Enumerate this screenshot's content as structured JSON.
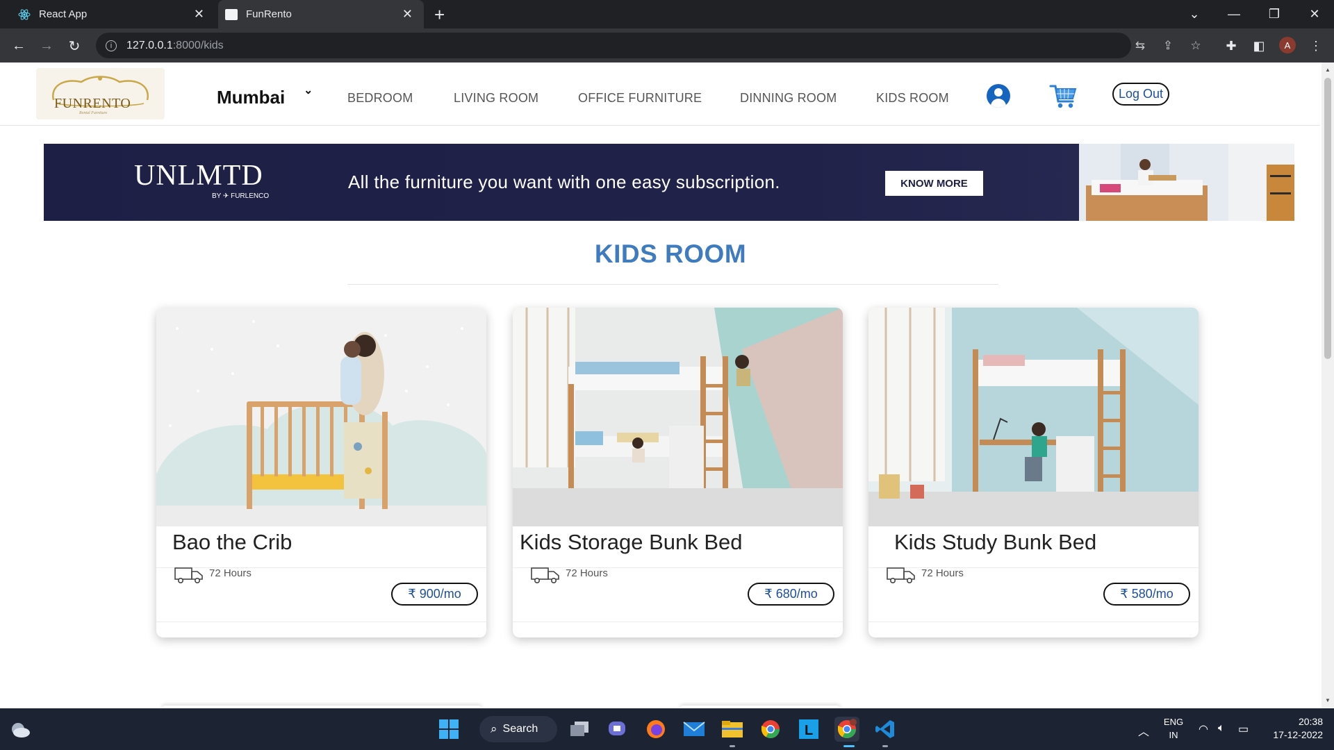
{
  "browser": {
    "tabs": [
      {
        "title": "React App",
        "close": "✕"
      },
      {
        "title": "FunRento",
        "close": "✕"
      }
    ],
    "new_tab": "+",
    "url_host": "127.0.0.1",
    "url_rest": ":8000/kids",
    "profile_initial": "A"
  },
  "site": {
    "logo_text": "FUNRENTO",
    "logo_sub": "Rental Furniture",
    "city": "Mumbai",
    "nav": [
      "BEDROOM",
      "LIVING ROOM",
      "OFFICE FURNITURE",
      "DINNING ROOM",
      "KIDS ROOM"
    ],
    "logout_label": "Log Out"
  },
  "banner": {
    "brand": "UNLMTD",
    "by_line": "BY ✈ FURLENCO",
    "text": "All the furniture you want with one easy subscription.",
    "cta": "KNOW MORE"
  },
  "section": {
    "title": "KIDS ROOM"
  },
  "products": [
    {
      "name": "Bao the Crib",
      "delivery": "72 Hours",
      "price": "₹ 900/mo"
    },
    {
      "name": "Kids Storage Bunk Bed",
      "delivery": "72 Hours",
      "price": "₹ 680/mo"
    },
    {
      "name": "Kids Study Bunk Bed",
      "delivery": "72 Hours",
      "price": "₹ 580/mo"
    }
  ],
  "taskbar": {
    "search_label": "Search",
    "lang_line1": "ENG",
    "lang_line2": "IN",
    "time": "20:38",
    "date": "17-12-2022"
  },
  "colors": {
    "accent_blue": "#3f7cbf",
    "banner_navy": "#1d1f45",
    "price_text": "#1c4f9c"
  }
}
